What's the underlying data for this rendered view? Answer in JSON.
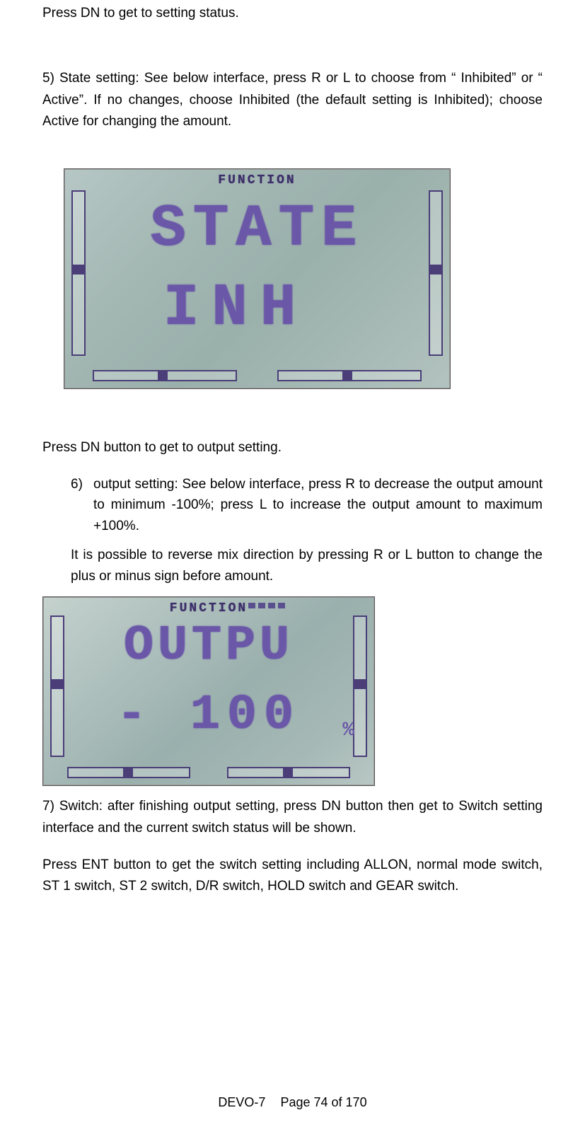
{
  "intro_line": "Press DN    to get to setting status.",
  "step5": "5) State setting: See below interface, press R or L to choose from “ Inhibited” or “ Active”. If no changes, choose Inhibited (the default setting is Inhibited); choose Active for changing the amount.",
  "lcd1": {
    "title": "FUNCTION",
    "line1": "STATE",
    "line2": "INH"
  },
  "after_lcd1": "Press DN button to get to output setting.",
  "step6_num": "6)",
  "step6_text": "output setting: See below interface, press R to decrease the output amount to minimum -100%; press L to increase the output amount to maximum +100%.",
  "step6_note": "It is possible to reverse mix direction by pressing R or L button to change the plus or minus sign before amount.",
  "lcd2": {
    "title": "FUNCTION",
    "line1": "OUTPU",
    "line2": "- 100",
    "pct": "%"
  },
  "step7": "7) Switch: after finishing output setting, press DN button then get to Switch setting interface and the current switch status will be shown.",
  "step7b": "Press ENT button to get the switch setting including ALLON, normal mode switch, ST 1 switch, ST 2 switch, D/R switch, HOLD switch and GEAR switch.",
  "footer_model": "DEVO-7",
  "footer_page": "Page 74 of 170"
}
